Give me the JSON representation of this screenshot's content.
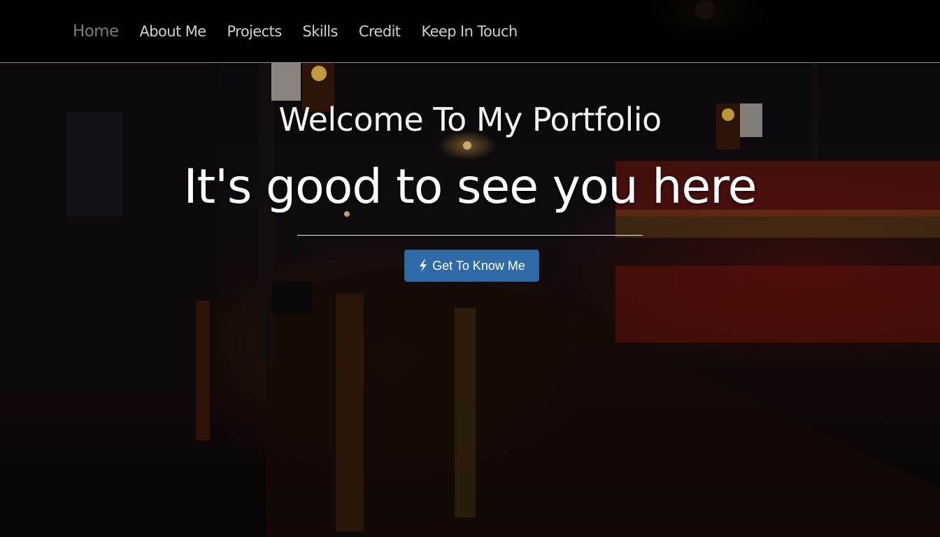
{
  "nav": {
    "items": [
      {
        "label": "Home",
        "active": true
      },
      {
        "label": "About Me",
        "active": false
      },
      {
        "label": "Projects",
        "active": false
      },
      {
        "label": "Skills",
        "active": false
      },
      {
        "label": "Credit",
        "active": false
      },
      {
        "label": "Keep In Touch",
        "active": false
      }
    ]
  },
  "hero": {
    "subtitle": "Welcome To My Portfolio",
    "title": "It's good to see you here",
    "cta_label": "Get To Know Me",
    "cta_icon": "bolt-icon"
  },
  "colors": {
    "navbar_bg": "#000000",
    "nav_active": "#7b7b7b",
    "nav_text": "#cfcfcf",
    "cta_bg": "#2f6aa8",
    "hero_text": "#ffffff"
  }
}
